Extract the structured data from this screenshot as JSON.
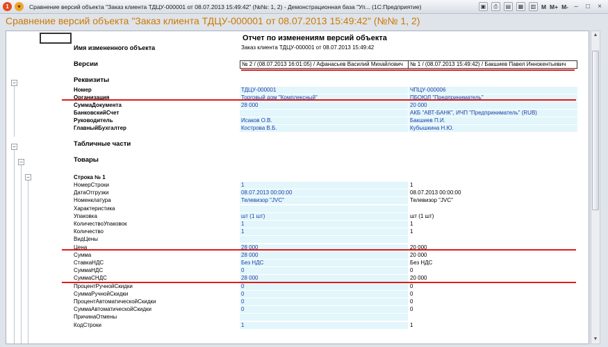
{
  "window": {
    "title": "Сравнение версий объекта \"Заказ клиента ТДЦУ-000001 от 08.07.2013 15:49:42\" (№№: 1, 2) - Демонстрационная база \"Уп... (1С:Предприятие)",
    "m_label": "M",
    "mplus_label": "M+",
    "mminus_label": "M-"
  },
  "heading": "Сравнение версий объекта \"Заказ клиента ТДЦУ-000001 от 08.07.2013 15:49:42\" (№№ 1, 2)",
  "report": {
    "title": "Отчет по изменениям версий объекта",
    "object_label": "Имя измененного объекта",
    "object_value": "Заказ клиента ТДЦУ-000001 от 08.07.2013 15:49:42",
    "versions_label": "Версии",
    "version_left": "№ 2 / (08.07.2013 16:01:05) / Афанасьев Василий Михайлович",
    "version_right": "№ 1 / (08.07.2013 15:49:42) / Бакшиев Павел Иннокентьевич",
    "requisites_title": "Реквизиты",
    "requisites": [
      {
        "name": "Номер",
        "v2": "ТДЦУ-000001",
        "v1": "ЧПЦУ-000006"
      },
      {
        "name": "Организация",
        "v2": "Торговый дом \"Комплексный\"",
        "v1": "ПБОЮЛ \"Предприниматель\""
      },
      {
        "name": "СуммаДокумента",
        "v2": "28 000",
        "v1": "20 000"
      },
      {
        "name": "БанковскийСчет",
        "v2": "",
        "v1": "АКБ \"АВТ-БАНК\", ИЧП \"Предприниматель\" (RUB)"
      },
      {
        "name": "Руководитель",
        "v2": "Исаков О.В.",
        "v1": "Бакшиев П.И."
      },
      {
        "name": "ГлавныйБухгалтер",
        "v2": "Кострова В.Б.",
        "v1": "Кубышкина Н.Ю."
      }
    ],
    "tabular_title": "Табличные части",
    "goods_title": "Товары",
    "row_title": "Строка № 1",
    "goods": [
      {
        "name": "НомерСтроки",
        "v2": "1",
        "v1": "1"
      },
      {
        "name": "ДатаОтгрузки",
        "v2": "08.07.2013 00:00:00",
        "v1": "08.07.2013 00:00:00"
      },
      {
        "name": "Номенклатура",
        "v2": "Телевизор \"JVC\"",
        "v1": "Телевизор \"JVC\""
      },
      {
        "name": "Характеристика",
        "v2": "",
        "v1": ""
      },
      {
        "name": "Упаковка",
        "v2": "шт (1 шт)",
        "v1": "шт (1 шт)"
      },
      {
        "name": "КоличествоУпаковок",
        "v2": "1",
        "v1": "1"
      },
      {
        "name": "Количество",
        "v2": "1",
        "v1": "1"
      },
      {
        "name": "ВидЦены",
        "v2": "",
        "v1": ""
      },
      {
        "name": "Цена",
        "v2": "28 000",
        "v1": "20 000"
      },
      {
        "name": "Сумма",
        "v2": "28 000",
        "v1": "20 000"
      },
      {
        "name": "СтавкаНДС",
        "v2": "Без НДС",
        "v1": "Без НДС"
      },
      {
        "name": "СуммаНДС",
        "v2": "0",
        "v1": "0"
      },
      {
        "name": "СуммаСНДС",
        "v2": "28 000",
        "v1": "20 000"
      },
      {
        "name": "ПроцентРучнойСкидки",
        "v2": "0",
        "v1": "0"
      },
      {
        "name": "СуммаРучнойСкидки",
        "v2": "0",
        "v1": "0"
      },
      {
        "name": "ПроцентАвтоматическойСкидки",
        "v2": "0",
        "v1": "0"
      },
      {
        "name": "СуммаАвтоматическойСкидки",
        "v2": "0",
        "v1": "0"
      },
      {
        "name": "ПричинаОтмены",
        "v2": "",
        "v1": ""
      },
      {
        "name": "КодСтроки",
        "v2": "1",
        "v1": "1"
      }
    ]
  },
  "colors": {
    "heading": "#cc7a00",
    "highlight": "#e2f6fb",
    "value_blue": "#1f3fa6",
    "underline_red": "#e01a1a"
  }
}
